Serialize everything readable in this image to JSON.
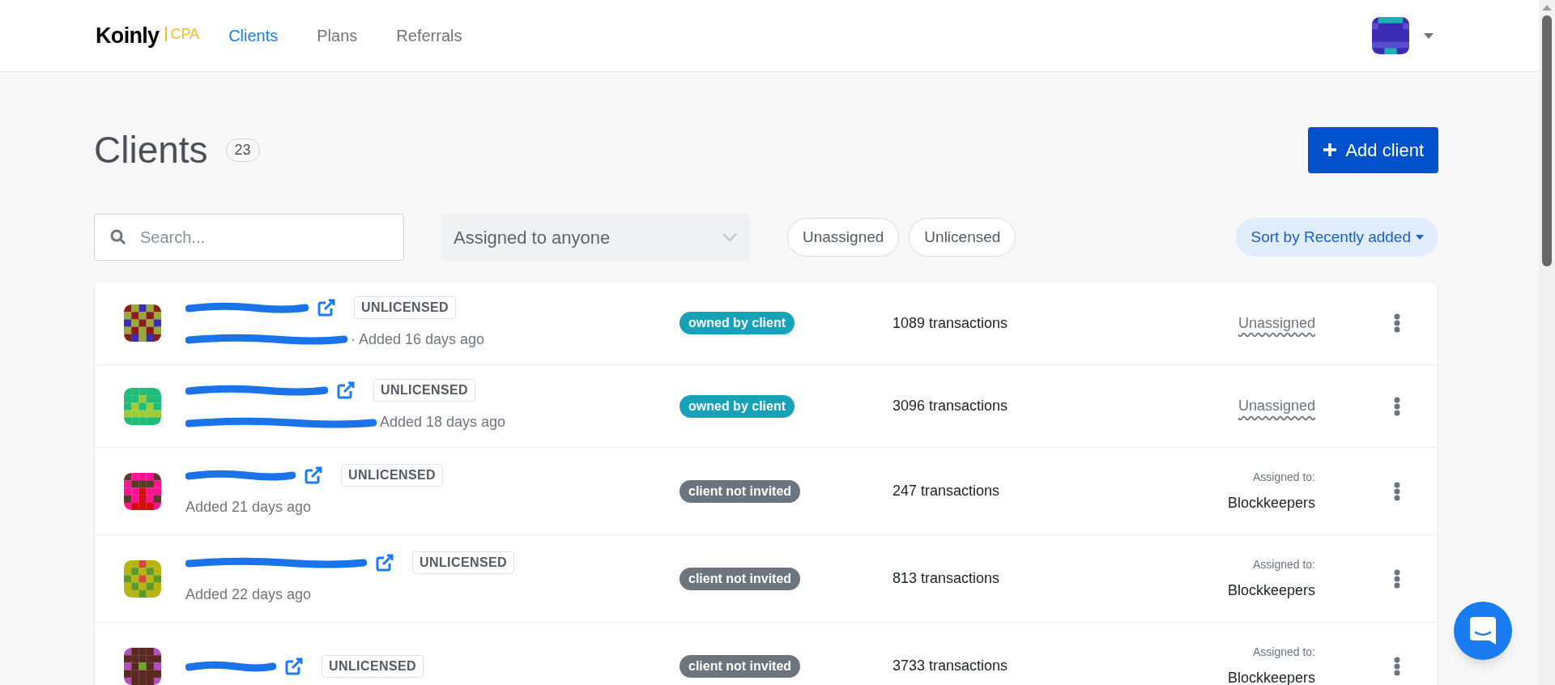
{
  "nav": {
    "logo": "Koinly",
    "logo_suffix": "CPA",
    "links": [
      {
        "label": "Clients",
        "selected": true
      },
      {
        "label": "Plans",
        "selected": false
      },
      {
        "label": "Referrals",
        "selected": false
      }
    ]
  },
  "header": {
    "title": "Clients",
    "count": "23",
    "add_button": "Add client"
  },
  "filters": {
    "search": {
      "placeholder": "Search..."
    },
    "assignee_select": "Assigned to anyone",
    "chips": [
      {
        "label": "Unassigned",
        "selected": false
      },
      {
        "label": "Unlicensed",
        "selected": false
      }
    ],
    "sort": "Sort by Recently added"
  },
  "clients": [
    {
      "license": "UNLICENSED",
      "email_redacted": true,
      "added": "· Added 16 days ago",
      "status": {
        "kind": "owned",
        "label": "owned by client"
      },
      "transactions": "1089 transactions",
      "assignment": {
        "kind": "unassigned",
        "name": "Unassigned"
      }
    },
    {
      "license": "UNLICENSED",
      "email_redacted": true,
      "added": "Added 18 days ago",
      "status": {
        "kind": "owned",
        "label": "owned by client"
      },
      "transactions": "3096 transactions",
      "assignment": {
        "kind": "unassigned",
        "name": "Unassigned"
      }
    },
    {
      "license": "UNLICENSED",
      "email_redacted": false,
      "added": "Added 21 days ago",
      "status": {
        "kind": "not_invited",
        "label": "client not invited"
      },
      "transactions": "247 transactions",
      "assignment": {
        "kind": "assigned",
        "label": "Assigned to:",
        "name": "Blockkeepers"
      }
    },
    {
      "license": "UNLICENSED",
      "email_redacted": false,
      "added": "Added 22 days ago",
      "status": {
        "kind": "not_invited",
        "label": "client not invited"
      },
      "transactions": "813 transactions",
      "assignment": {
        "kind": "assigned",
        "label": "Assigned to:",
        "name": "Blockkeepers"
      }
    },
    {
      "license": "UNLICENSED",
      "email_redacted": false,
      "status": {
        "kind": "not_invited",
        "label": "client not invited"
      },
      "transactions": "3733 transactions",
      "assignment": {
        "kind": "assigned",
        "label": "Assigned to:",
        "name": "Blockkeepers"
      }
    }
  ]
}
